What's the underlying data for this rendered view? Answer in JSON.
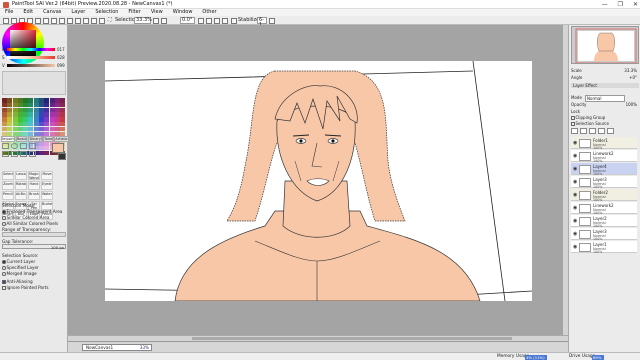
{
  "window": {
    "title": "PaintTool SAI Ver.2 (64bit) Preview.2020.08.28 - NewCanvas1 (*)",
    "controls": [
      "—",
      "❐",
      "✕"
    ]
  },
  "menu": [
    "File",
    "Edit",
    "Canvas",
    "Layer",
    "Selection",
    "Filter",
    "View",
    "Window",
    "Other"
  ],
  "toolbar": {
    "selection_label": "Selection",
    "zoom": "33.3%",
    "angle": "0.0°",
    "stabilizer_label": "Stabilizer",
    "stabilizer_value": "6-1"
  },
  "color": {
    "sliders": [
      {
        "label": "H",
        "value": "017"
      },
      {
        "label": "S",
        "value": "028"
      },
      {
        "label": "V",
        "value": "099"
      }
    ],
    "current_color": "#f8c7a8"
  },
  "left_tabs": [
    "Import",
    "Basic",
    "Binary",
    "Tone",
    "Artistic"
  ],
  "tools": [
    "Selection",
    "Lasso",
    "Magic Wand",
    "Move",
    "Zoom",
    "Rotate",
    "Hand",
    "Eyedropper",
    "Pencil",
    "AirBrush",
    "Brush",
    "Water",
    "Marker",
    "Eraser",
    "Sel Pen",
    "Bucket",
    "Binary",
    "Blur",
    "Edge",
    "Pencil2"
  ],
  "selection_options": {
    "mode_label": "Selection Mode:",
    "modes": [
      {
        "label": "Enclosed Transparent Area",
        "checked": true
      },
      {
        "label": "Similar Colored Area",
        "checked": false
      },
      {
        "label": "All Similar Colored Pixels",
        "checked": false
      }
    ],
    "range_label": "Range of Transparency:",
    "gap_label": "Gap Tolerance:",
    "gap_value": "100 px",
    "source_label": "Selection Source:",
    "sources": [
      {
        "label": "Current Layer",
        "checked": true
      },
      {
        "label": "Specified Layer",
        "checked": false
      },
      {
        "label": "Merged Image",
        "checked": false
      }
    ],
    "antialias_label": "Anti-Aliasing",
    "ignore_label": "Ignore Painted Parts"
  },
  "document_tab": {
    "name": "NewCanvas1",
    "zoom": "33%"
  },
  "status": {
    "memory_label": "Memory Usage",
    "memory_value": "4% (11%)",
    "drive_label": "Drive Usage",
    "drive_value": "89%"
  },
  "navigator": {
    "scale_label": "Scale",
    "scale_value": "33.3%",
    "angle_label": "Angle",
    "angle_value": "+0°"
  },
  "layer_panel": {
    "effect_label": "Layer Effect",
    "mode_label": "Mode",
    "mode_value": "Normal",
    "opacity_label": "Opacity",
    "opacity_value": "100%",
    "lock_label": "Lock",
    "clipping_label": "Clipping Group",
    "selsource_label": "Selection Source",
    "layers": [
      {
        "name": "Folder1",
        "mode": "Normal",
        "opacity": "100%",
        "kind": "folder"
      },
      {
        "name": "Linework2",
        "mode": "Normal",
        "opacity": "100%",
        "kind": "layer"
      },
      {
        "name": "Layer4",
        "mode": "Normal",
        "opacity": "100%",
        "kind": "selected"
      },
      {
        "name": "Layer3",
        "mode": "Normal",
        "opacity": "100%",
        "kind": "layer"
      },
      {
        "name": "Folder2",
        "mode": "Normal",
        "opacity": "100%",
        "kind": "folder"
      },
      {
        "name": "Linework2",
        "mode": "Normal",
        "opacity": "100%",
        "kind": "layer"
      },
      {
        "name": "Layer2",
        "mode": "Normal",
        "opacity": "100%",
        "kind": "layer"
      },
      {
        "name": "Layer3",
        "mode": "Normal",
        "opacity": "100%",
        "kind": "layer"
      },
      {
        "name": "Layer1",
        "mode": "Normal",
        "opacity": "100%",
        "kind": "layer"
      }
    ]
  },
  "colors": {
    "skin": "#f8c7a8",
    "panel": "#e9e9e9",
    "selected_layer": "#c9d2f0",
    "accent": "#4a78d2"
  }
}
